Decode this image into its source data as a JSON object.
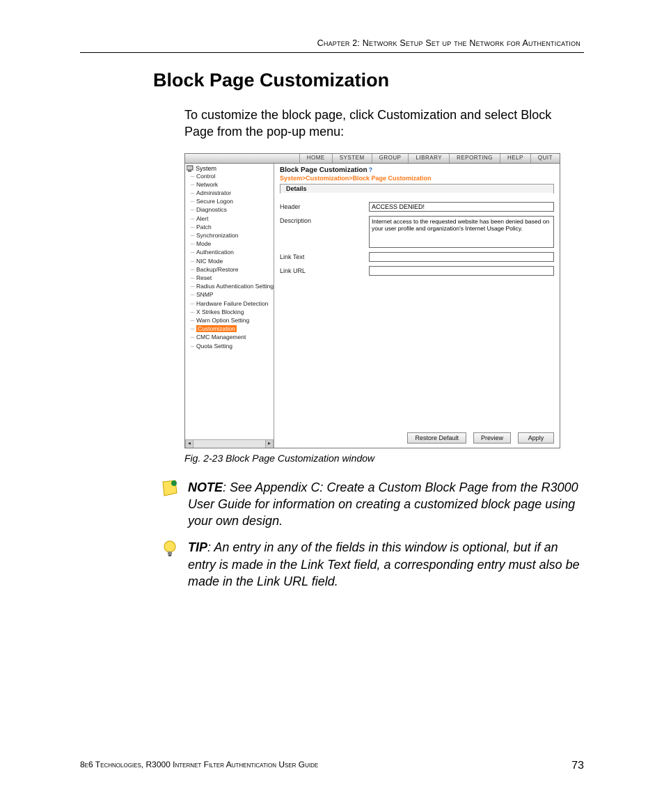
{
  "running_head": "Chapter 2: Network Setup  Set up the Network for Authentication",
  "heading": "Block Page Customization",
  "intro": "To customize the block page, click Customization and select Block Page from the pop-up menu:",
  "caption": "Fig. 2-23  Block Page Customization window",
  "note_label": "NOTE",
  "note_text": ": See Appendix C: Create a Custom Block Page from the R3000 User Guide for information on creating a customized block page using your own design.",
  "tip_label": "TIP",
  "tip_text": ": An entry in any of the fields in this window is optional, but if an entry is made in the Link Text field, a corresponding entry must also be made in the Link URL field.",
  "footer_left": "8e6 Technologies, R3000 Internet Filter Authentication User Guide",
  "footer_page": "73",
  "app": {
    "menubar": [
      "HOME",
      "SYSTEM",
      "GROUP",
      "LIBRARY",
      "REPORTING",
      "HELP",
      "QUIT"
    ],
    "tree_root": "System",
    "tree_items": [
      "Control",
      "Network",
      "Administrator",
      "Secure Logon",
      "Diagnostics",
      "Alert",
      "Patch",
      "Synchronization",
      "Mode",
      "Authentication",
      "NIC Mode",
      "Backup/Restore",
      "Reset",
      "Radius Authentication Setting",
      "SNMP",
      "Hardware Failure Detection",
      "X Strikes Blocking",
      "Warn Option Setting",
      "Customization",
      "CMC Management",
      "Quota Setting"
    ],
    "tree_selected_index": 18,
    "panel_title": "Block Page Customization",
    "breadcrumb": "System>Customization>Block Page Customization",
    "tab": "Details",
    "form": {
      "header_label": "Header",
      "header_value": "ACCESS DENIED!",
      "description_label": "Description",
      "description_value": "Internet access to the requested website has been denied based on your user profile and organization's Internet Usage Policy.",
      "link_text_label": "Link Text",
      "link_text_value": "",
      "link_url_label": "Link URL",
      "link_url_value": ""
    },
    "buttons": {
      "restore": "Restore Default",
      "preview": "Preview",
      "apply": "Apply"
    }
  }
}
